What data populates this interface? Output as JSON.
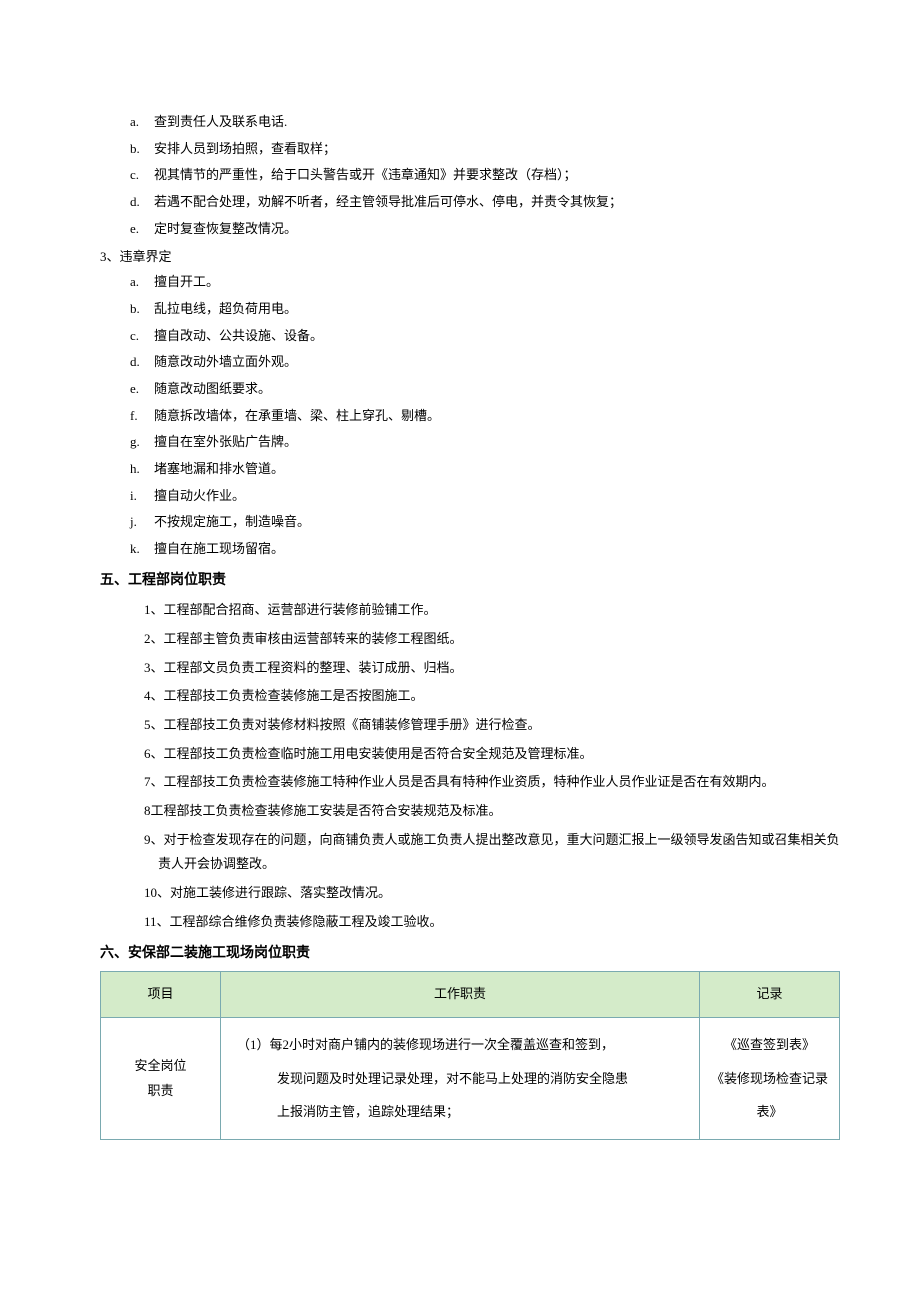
{
  "sublist_a": [
    {
      "marker": "a.",
      "text": "查到责任人及联系电话."
    },
    {
      "marker": "b.",
      "text": "安排人员到场拍照，查看取样；"
    },
    {
      "marker": "c.",
      "text": "视其情节的严重性，给于口头警告或开《违章通知》并要求整改（存档）；"
    },
    {
      "marker": "d.",
      "text": "若遇不配合处理，劝解不听者，经主管领导批准后可停水、停电，并责令其恢复；"
    },
    {
      "marker": "e.",
      "text": "定时复查恢复整改情况。"
    }
  ],
  "section3_title": "3、违章界定",
  "section3_items": [
    {
      "marker": "a.",
      "text": "擅自开工。"
    },
    {
      "marker": "b.",
      "text": "乱拉电线，超负荷用电。"
    },
    {
      "marker": "c.",
      "text": "擅自改动、公共设施、设备。"
    },
    {
      "marker": "d.",
      "text": "随意改动外墙立面外观。"
    },
    {
      "marker": "e.",
      "text": "随意改动图纸要求。"
    },
    {
      "marker": "f.",
      "text": "随意拆改墙体，在承重墙、梁、柱上穿孔、剔槽。"
    },
    {
      "marker": "g.",
      "text": "擅自在室外张贴广告牌。"
    },
    {
      "marker": "h.",
      "text": "堵塞地漏和排水管道。"
    },
    {
      "marker": "i.",
      "text": "擅自动火作业。"
    },
    {
      "marker": "j.",
      "text": "不按规定施工，制造噪音。"
    },
    {
      "marker": "k.",
      "text": "擅自在施工现场留宿。"
    }
  ],
  "section5_title": "五、工程部岗位职责",
  "section5_items": [
    "1、工程部配合招商、运营部进行装修前验铺工作。",
    "2、工程部主管负责审核由运营部转来的装修工程图纸。",
    "3、工程部文员负责工程资料的整理、装订成册、归档。",
    "4、工程部技工负责检查装修施工是否按图施工。",
    "5、工程部技工负责对装修材料按照《商铺装修管理手册》进行检查。",
    "6、工程部技工负责检查临时施工用电安装使用是否符合安全规范及管理标准。",
    "7、工程部技工负责检查装修施工特种作业人员是否具有特种作业资质，特种作业人员作业证是否在有效期内。",
    "8工程部技工负责检查装修施工安装是否符合安装规范及标准。",
    "9、对于检查发现存在的问题，向商铺负责人或施工负责人提出整改意见，重大问题汇报上一级领导发函告知或召集相关负责人开会协调整改。",
    "10、对施工装修进行跟踪、落实整改情况。",
    "11、工程部综合维修负责装修隐蔽工程及竣工验收。"
  ],
  "section6_title": "六、安保部二装施工现场岗位职责",
  "table": {
    "headers": {
      "item": "项目",
      "duty": "工作职责",
      "record": "记录"
    },
    "row1": {
      "item_line1": "安全岗位",
      "item_line2": "职责",
      "duty_line1": "（1）每2小时对商户铺内的装修现场进行一次全覆盖巡查和签到，",
      "duty_line2": "发现问题及时处理记录处理，对不能马上处理的消防安全隐患",
      "duty_line3": "上报消防主管，追踪处理结果；",
      "record_line1": "《巡查签到表》",
      "record_line2": "《装修现场检查记录",
      "record_line3": "表》"
    }
  }
}
